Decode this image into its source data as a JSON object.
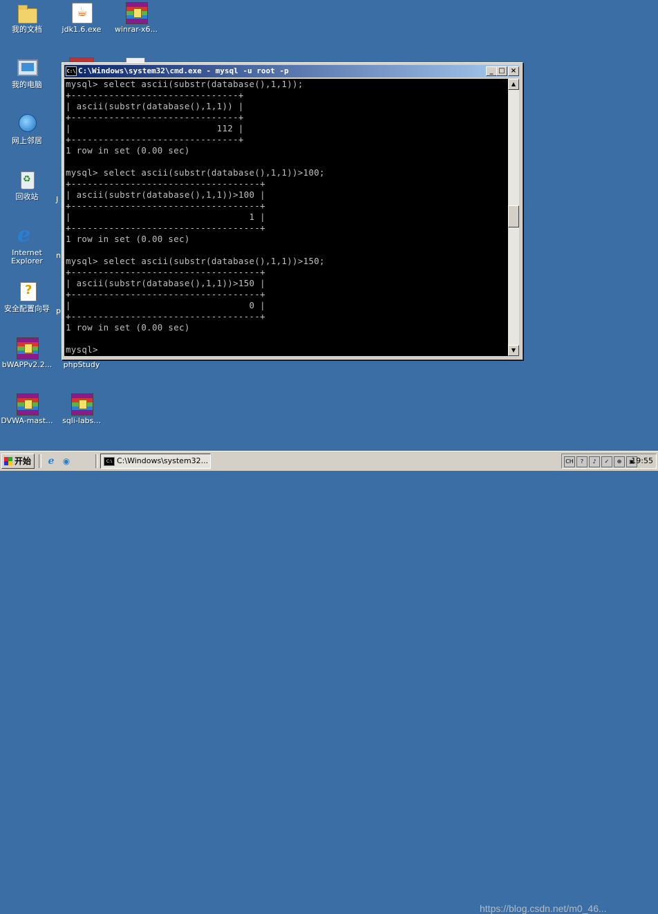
{
  "desktop": {
    "icons": [
      {
        "label": "我的文档",
        "icon": "folder-icon"
      },
      {
        "label": "jdk1.6.exe",
        "icon": "java-icon"
      },
      {
        "label": "winrar-x6...",
        "icon": "winrar-icon"
      },
      {
        "label": "我的电脑",
        "icon": "computer-icon"
      },
      {
        "label": "网上邻居",
        "icon": "network-icon"
      },
      {
        "label": "回收站",
        "icon": "recycle-bin-icon"
      },
      {
        "label": "Internet Explorer",
        "icon": "ie-icon"
      },
      {
        "label": "安全配置向导",
        "icon": "security-wizard-icon"
      },
      {
        "label": "bWAPPv2.2...",
        "icon": "winrar-icon"
      },
      {
        "label": "phpStudy",
        "icon": "winrar-icon"
      },
      {
        "label": "DVWA-mast...",
        "icon": "winrar-icon"
      },
      {
        "label": "sqli-labs...",
        "icon": "winrar-icon"
      }
    ],
    "partial_labels": [
      "J",
      "n",
      "p"
    ]
  },
  "console_window": {
    "title": "C:\\Windows\\system32\\cmd.exe - mysql -u root -p",
    "icon_text": "C:\\",
    "minimize": "_",
    "maximize": "□",
    "close": "×",
    "output": "mysql> select ascii(substr(database(),1,1));\n+-------------------------------+\n| ascii(substr(database(),1,1)) |\n+-------------------------------+\n|                           112 |\n+-------------------------------+\n1 row in set (0.00 sec)\n\nmysql> select ascii(substr(database(),1,1))>100;\n+-----------------------------------+\n| ascii(substr(database(),1,1))>100 |\n+-----------------------------------+\n|                                 1 |\n+-----------------------------------+\n1 row in set (0.00 sec)\n\nmysql> select ascii(substr(database(),1,1))>150;\n+-----------------------------------+\n| ascii(substr(database(),1,1))>150 |\n+-----------------------------------+\n|                                 0 |\n+-----------------------------------+\n1 row in set (0.00 sec)\n\nmysql>",
    "scroll_up": "▲",
    "scroll_down": "▼"
  },
  "taskbar": {
    "start_label": "开始",
    "task_label": "C:\\Windows\\system32...",
    "task_icon_text": "C:\\",
    "watermark": "https://blog.csdn.net/m0_46...",
    "clock": "19:55",
    "tray_icons": [
      "CH",
      "?",
      "♪",
      "✓",
      "⊕",
      "▣"
    ]
  }
}
